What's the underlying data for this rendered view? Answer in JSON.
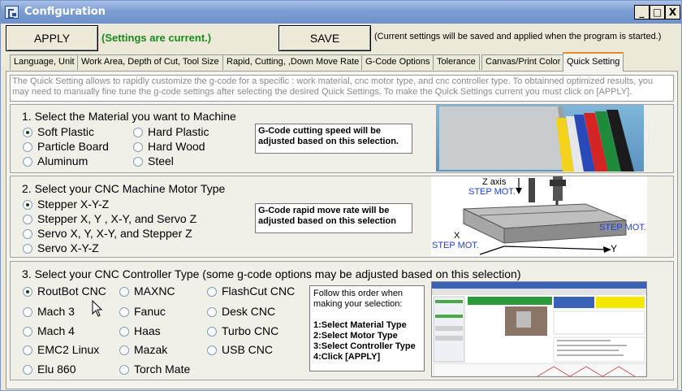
{
  "window": {
    "title": "Configuration",
    "buttons": {
      "minimize": "_",
      "maximize": "□",
      "close": "X"
    }
  },
  "toolbar": {
    "apply_label": "APPLY",
    "status_text": "(Settings are current.)",
    "save_label": "SAVE",
    "save_note": "(Current settings will be saved and applied when the program is started.)"
  },
  "tabs": [
    {
      "label": "Language, Unit"
    },
    {
      "label": "Work Area, Depth of Cut, Tool Size"
    },
    {
      "label": "Rapid, Cutting, ,Down Move Rate"
    },
    {
      "label": "G-Code Options"
    },
    {
      "label": "Tolerance"
    },
    {
      "label": "Canvas/Print Color"
    },
    {
      "label": "Quick Setting"
    }
  ],
  "intro_text": "The Quick Setting allows to rapidly customize the g-code for a specific : work material, cnc motor type, and cnc controller type. To obtainned optimized results, you may need to manually  fine tune the g-code settings after selecting the desired Quick Settings. To make the Quick Settings current you must click on [APPLY].",
  "material": {
    "title": "1. Select the Material you want  to Machine",
    "options": [
      "Soft Plastic",
      "Hard Plastic",
      "Particle Board",
      "Hard Wood",
      "Aluminum",
      "Steel"
    ],
    "selected": "Soft Plastic",
    "note": "G-Code cutting speed will be adjusted based on this selection."
  },
  "motor": {
    "title": "2. Select your CNC Machine Motor Type",
    "options": [
      "Stepper X-Y-Z",
      "Stepper X, Y , X-Y, and Servo Z",
      "Servo X, Y, X-Y, and Stepper Z",
      "Servo X-Y-Z"
    ],
    "selected": "Stepper X-Y-Z",
    "note": "G-Code rapid move rate will be adjusted based on this selection",
    "diagram": {
      "z_axis": "Z axis",
      "step_mot": "STEP MOT.",
      "x": "X",
      "y": "Y"
    }
  },
  "controller": {
    "title": "3. Select your CNC Controller Type (some g-code options may be adjusted based on this selection)",
    "options": [
      "RoutBot CNC",
      "MAXNC",
      "FlashCut CNC",
      "Mach 3",
      "Fanuc",
      "Desk CNC",
      "Mach 4",
      "Haas",
      "Turbo CNC",
      "EMC2 Linux",
      "Mazak",
      "USB CNC",
      "Elu 860",
      "Torch Mate"
    ],
    "selected": "RoutBot CNC",
    "order_note": {
      "heading": "Follow this order when making your selection:",
      "steps": [
        "1:Select Material Type",
        "2:Select Motor Type",
        "3:Select Controller Type",
        "4:Click [APPLY]"
      ]
    }
  },
  "colors": {
    "status_green": "#1a8a1a",
    "title_bar": "#7d9ed3",
    "step_blue": "#1f3fd8"
  }
}
